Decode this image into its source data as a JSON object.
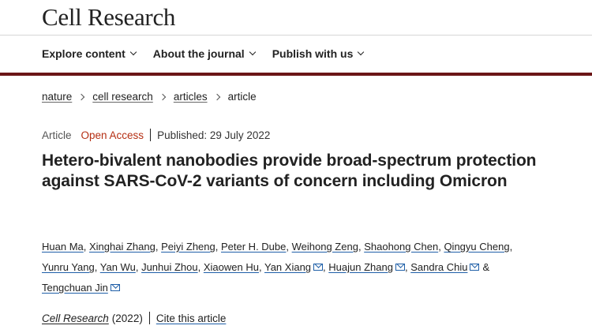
{
  "header": {
    "brand": "Cell Research",
    "nav": [
      {
        "label": "Explore content"
      },
      {
        "label": "About the journal"
      },
      {
        "label": "Publish with us"
      }
    ]
  },
  "breadcrumb": {
    "items": [
      "nature",
      "cell research",
      "articles"
    ],
    "current": "article"
  },
  "meta": {
    "type": "Article",
    "access": "Open Access",
    "published": "Published: 29 July 2022"
  },
  "article": {
    "title": "Hetero-bivalent nanobodies provide broad-spectrum protection against SARS-CoV-2 variants of concern including Omicron",
    "authors": [
      {
        "name": "Huan Ma",
        "email": false
      },
      {
        "name": "Xinghai Zhang",
        "email": false
      },
      {
        "name": "Peiyi Zheng",
        "email": false
      },
      {
        "name": "Peter H. Dube",
        "email": false
      },
      {
        "name": "Weihong Zeng",
        "email": false
      },
      {
        "name": "Shaohong Chen",
        "email": false
      },
      {
        "name": "Qingyu Cheng",
        "email": false
      },
      {
        "name": "Yunru Yang",
        "email": false
      },
      {
        "name": "Yan Wu",
        "email": false
      },
      {
        "name": "Junhui Zhou",
        "email": false
      },
      {
        "name": "Xiaowen Hu",
        "email": false
      },
      {
        "name": "Yan Xiang",
        "email": true
      },
      {
        "name": "Huajun Zhang",
        "email": true
      },
      {
        "name": "Sandra Chiu",
        "email": true
      },
      {
        "name": "Tengchuan Jin",
        "email": true
      }
    ],
    "ampersand": "&"
  },
  "citation": {
    "journal": "Cell Research",
    "year": "(2022)",
    "cite_label": "Cite this article"
  },
  "colors": {
    "accent_bar": "#6b1517",
    "open_access": "#b52f13",
    "link_underline": "#1f5fa8"
  }
}
